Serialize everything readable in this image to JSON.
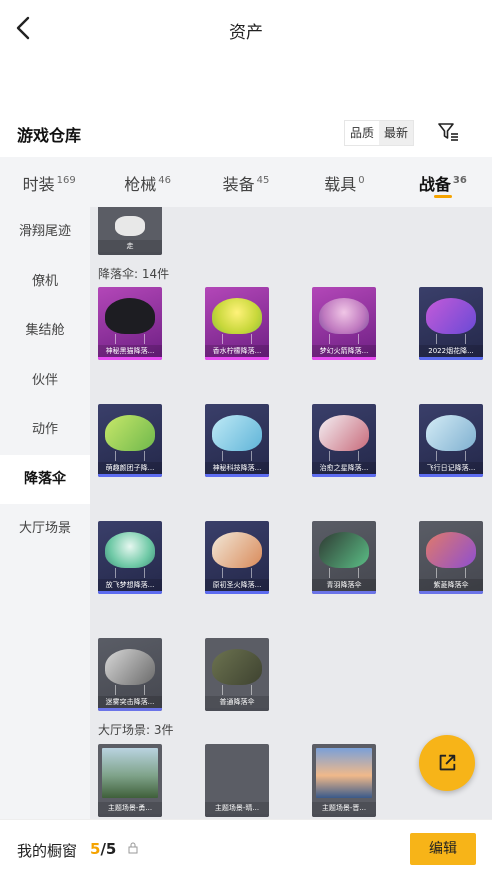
{
  "header": {
    "title": "资产"
  },
  "warehouse": {
    "title": "游戏仓库",
    "sort_options": [
      "品质",
      "最新"
    ]
  },
  "tabs": [
    {
      "label": "时装",
      "count": "169"
    },
    {
      "label": "枪械",
      "count": "46"
    },
    {
      "label": "装备",
      "count": "45"
    },
    {
      "label": "载具",
      "count": "0"
    },
    {
      "label": "战备",
      "count": "36",
      "active": true
    }
  ],
  "sidebar": {
    "items": [
      "滑翔尾迹",
      "僚机",
      "集结舱",
      "伙伴",
      "动作",
      "降落伞",
      "大厅场景"
    ],
    "active": "降落伞"
  },
  "content": {
    "top_card": {
      "name": "走"
    },
    "parachute_section": "降落伞: 14件",
    "parachutes": [
      {
        "name": "神秘黑猫降落...",
        "quality": "purple"
      },
      {
        "name": "香水柠檬降落...",
        "quality": "purple"
      },
      {
        "name": "梦幻火箭降落...",
        "quality": "purple"
      },
      {
        "name": "2022烟花降...",
        "quality": "blue"
      },
      {
        "name": "萌趣颜团子降...",
        "quality": "blue"
      },
      {
        "name": "神秘科技降落...",
        "quality": "blue"
      },
      {
        "name": "治愈之星降落...",
        "quality": "blue"
      },
      {
        "name": "飞行日记降落...",
        "quality": "blue"
      },
      {
        "name": "放飞梦想降落...",
        "quality": "blue"
      },
      {
        "name": "原初圣火降落...",
        "quality": "blue"
      },
      {
        "name": "青羽降落伞",
        "quality": "gray"
      },
      {
        "name": "紫菱降落伞",
        "quality": "gray"
      },
      {
        "name": "迷雾突击降落...",
        "quality": "gray"
      },
      {
        "name": "普通降落伞",
        "quality": "plain"
      }
    ],
    "scene_section": "大厅场景: 3件",
    "scenes": [
      {
        "name": "主题场景-勇..."
      },
      {
        "name": "主题场景-晴..."
      },
      {
        "name": "主题场景-晋..."
      }
    ]
  },
  "showcase": {
    "label": "我的橱窗",
    "current": "5",
    "sep_total": "/5",
    "edit_label": "编辑"
  },
  "icons": {
    "back": "chevron-left-icon",
    "filter": "filter-icon",
    "lock": "lock-icon",
    "share": "external-link-icon"
  },
  "colors": {
    "accent": "#f7b418",
    "highlight": "#f5a300",
    "purple_quality": "#e74cf2",
    "blue_quality": "#5d6cf0"
  }
}
